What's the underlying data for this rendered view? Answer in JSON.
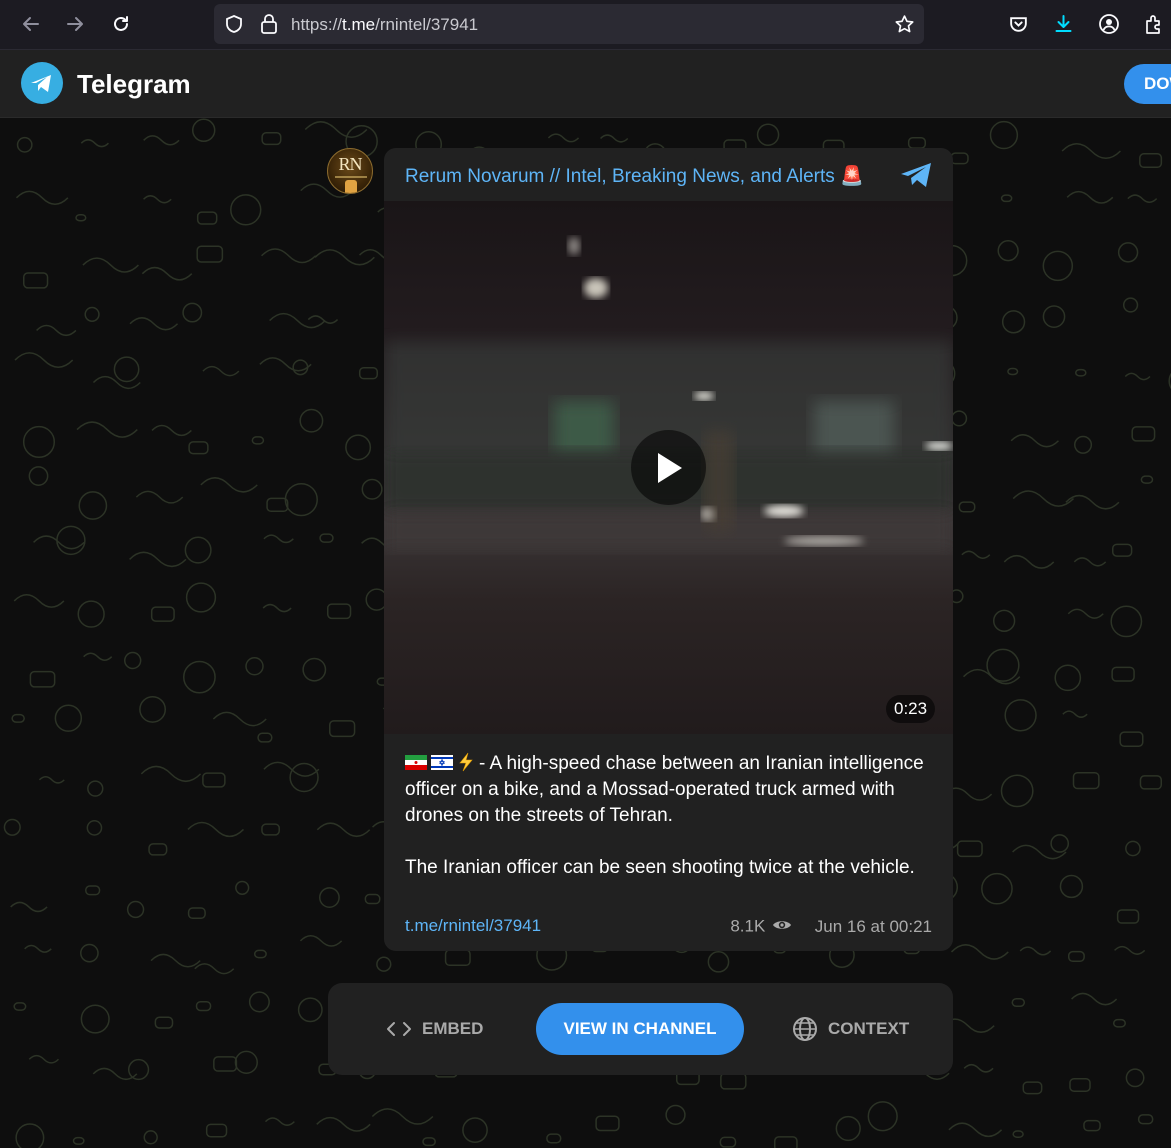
{
  "browser": {
    "url_prefix": "https://",
    "url_host": "t.me",
    "url_path": "/rnintel/37941",
    "icons": [
      "back-icon",
      "forward-icon",
      "reload-icon",
      "shield-icon",
      "lock-icon",
      "bookmark-star-icon",
      "pocket-icon",
      "download-icon",
      "account-icon",
      "extensions-icon"
    ]
  },
  "header": {
    "title": "Telegram",
    "download_label": "DOWNLOAD"
  },
  "post": {
    "avatar_initials": "RN",
    "channel_name": "Rerum Novarum // Intel, Breaking News, and Alerts 🚨",
    "video_duration": "0:23",
    "caption_line1": "- A high-speed chase between an Iranian intelligence officer on a bike, and a Mossad-operated truck armed with drones on the streets of Tehran.",
    "caption_line2": "The Iranian officer can be seen shooting twice at the vehicle.",
    "link": "t.me/rnintel/37941",
    "views": "8.1K",
    "date": "Jun 16 at 00:21"
  },
  "actions": {
    "embed": "EMBED",
    "view_in_channel": "VIEW IN CHANNEL",
    "context": "CONTEXT"
  },
  "colors": {
    "accent": "#3390ec",
    "link": "#5eb5f7",
    "card_bg": "#212121"
  }
}
